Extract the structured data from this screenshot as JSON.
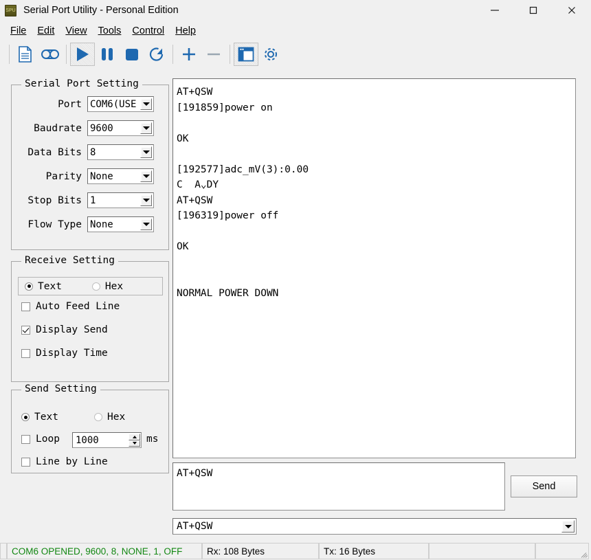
{
  "window": {
    "title": "Serial Port Utility - Personal Edition",
    "icon_label": "SPU",
    "icon_name": "app-icon",
    "controls": {
      "minimize": "minimize-icon",
      "maximize": "maximize-icon",
      "close": "close-icon"
    }
  },
  "menubar": {
    "items": [
      {
        "label": "File",
        "mnemonic": "F"
      },
      {
        "label": "Edit",
        "mnemonic": "E"
      },
      {
        "label": "View",
        "mnemonic": "V"
      },
      {
        "label": "Tools",
        "mnemonic": "T"
      },
      {
        "label": "Control",
        "mnemonic": "C"
      },
      {
        "label": "Help",
        "mnemonic": "H"
      }
    ]
  },
  "toolbar": {
    "buttons": [
      {
        "name": "new-file-icon",
        "pressed": false
      },
      {
        "name": "record-icon",
        "pressed": false
      },
      {
        "name": "play-icon",
        "pressed": true
      },
      {
        "name": "pause-icon",
        "pressed": false
      },
      {
        "name": "stop-icon",
        "pressed": false
      },
      {
        "name": "refresh-icon",
        "pressed": false
      },
      {
        "name": "plus-icon",
        "pressed": false
      },
      {
        "name": "minus-icon",
        "pressed": false
      },
      {
        "name": "window-layout-icon",
        "pressed": true
      },
      {
        "name": "gear-icon",
        "pressed": false
      }
    ]
  },
  "serial_port_setting": {
    "title": "Serial Port Setting",
    "fields": [
      {
        "label": "Port",
        "value": "COM6(USE"
      },
      {
        "label": "Baudrate",
        "value": "9600"
      },
      {
        "label": "Data Bits",
        "value": "8"
      },
      {
        "label": "Parity",
        "value": "None"
      },
      {
        "label": "Stop Bits",
        "value": "1"
      },
      {
        "label": "Flow Type",
        "value": "None"
      }
    ]
  },
  "receive_setting": {
    "title": "Receive Setting",
    "mode": {
      "text_label": "Text",
      "hex_label": "Hex",
      "selected": "Text"
    },
    "checkboxes": [
      {
        "label": "Auto Feed Line",
        "checked": false
      },
      {
        "label": "Display Send",
        "checked": true
      },
      {
        "label": "Display Time",
        "checked": false
      }
    ]
  },
  "send_setting": {
    "title": "Send Setting",
    "mode": {
      "text_label": "Text",
      "hex_label": "Hex",
      "selected": "Text"
    },
    "loop": {
      "label": "Loop",
      "checked": false,
      "value": "1000",
      "unit": "ms"
    },
    "line_by_line": {
      "label": "Line by Line",
      "checked": false
    }
  },
  "terminal": {
    "lines": [
      "AT+QSW",
      "[191859]power on",
      "",
      "OK",
      "",
      "[192577]adc_mV(3):0.00",
      "C  A⌄DY",
      "AT+QSW",
      "[196319]power off",
      "",
      "OK",
      "",
      "",
      "NORMAL POWER DOWN"
    ]
  },
  "send_area": {
    "input_value": "AT+QSW",
    "send_button": "Send",
    "history_value": "AT+QSW"
  },
  "statusbar": {
    "connection": "COM6 OPENED, 9600, 8, NONE, 1, OFF",
    "connection_color": "#128712",
    "rx": "Rx: 108 Bytes",
    "tx": "Tx: 16 Bytes",
    "extra1": "",
    "extra2": ""
  },
  "colors": {
    "accent_blue": "#1f69b0",
    "window_bg": "#f0f0f0",
    "status_green": "#128712"
  }
}
